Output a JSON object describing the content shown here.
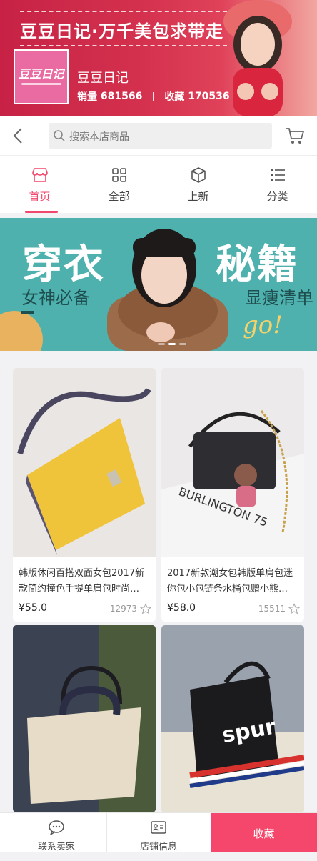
{
  "store": {
    "slogan": "豆豆日记·万千美包求带走",
    "logo_text": "豆豆日记",
    "name": "豆豆日记",
    "sales_label": "销量",
    "sales": "681566",
    "favorites_label": "收藏",
    "favorites": "170536"
  },
  "search": {
    "placeholder": "搜索本店商品"
  },
  "tabs": [
    {
      "label": "首页",
      "icon": "storefront-icon",
      "active": true
    },
    {
      "label": "全部",
      "icon": "grid-icon",
      "active": false
    },
    {
      "label": "上新",
      "icon": "box-icon",
      "active": false
    },
    {
      "label": "分类",
      "icon": "list-icon",
      "active": false
    }
  ],
  "banner": {
    "title_left": "穿衣",
    "title_right": "秘籍",
    "subtitle_left": "女神必备",
    "subtitle_right": "显瘦清单",
    "tag": "go!",
    "slides": 3,
    "active_slide": 1
  },
  "products": [
    {
      "title": "韩版休闲百搭双面女包2017新款简约撞色手提单肩包时尚…",
      "price": "¥55.0",
      "count": "12973"
    },
    {
      "title": "2017新款潮女包韩版单肩包迷你包小包链条水桶包赠小熊…",
      "price": "¥58.0",
      "count": "15511"
    },
    {
      "title": "",
      "price": "",
      "count": ""
    },
    {
      "title": "",
      "price": "",
      "count": ""
    }
  ],
  "bottom_bar": {
    "contact_label": "联系卖家",
    "info_label": "店铺信息",
    "favorite_label": "收藏"
  },
  "colors": {
    "accent": "#f2476c",
    "header_red": "#c72245",
    "banner_teal": "#3fa8a6"
  }
}
